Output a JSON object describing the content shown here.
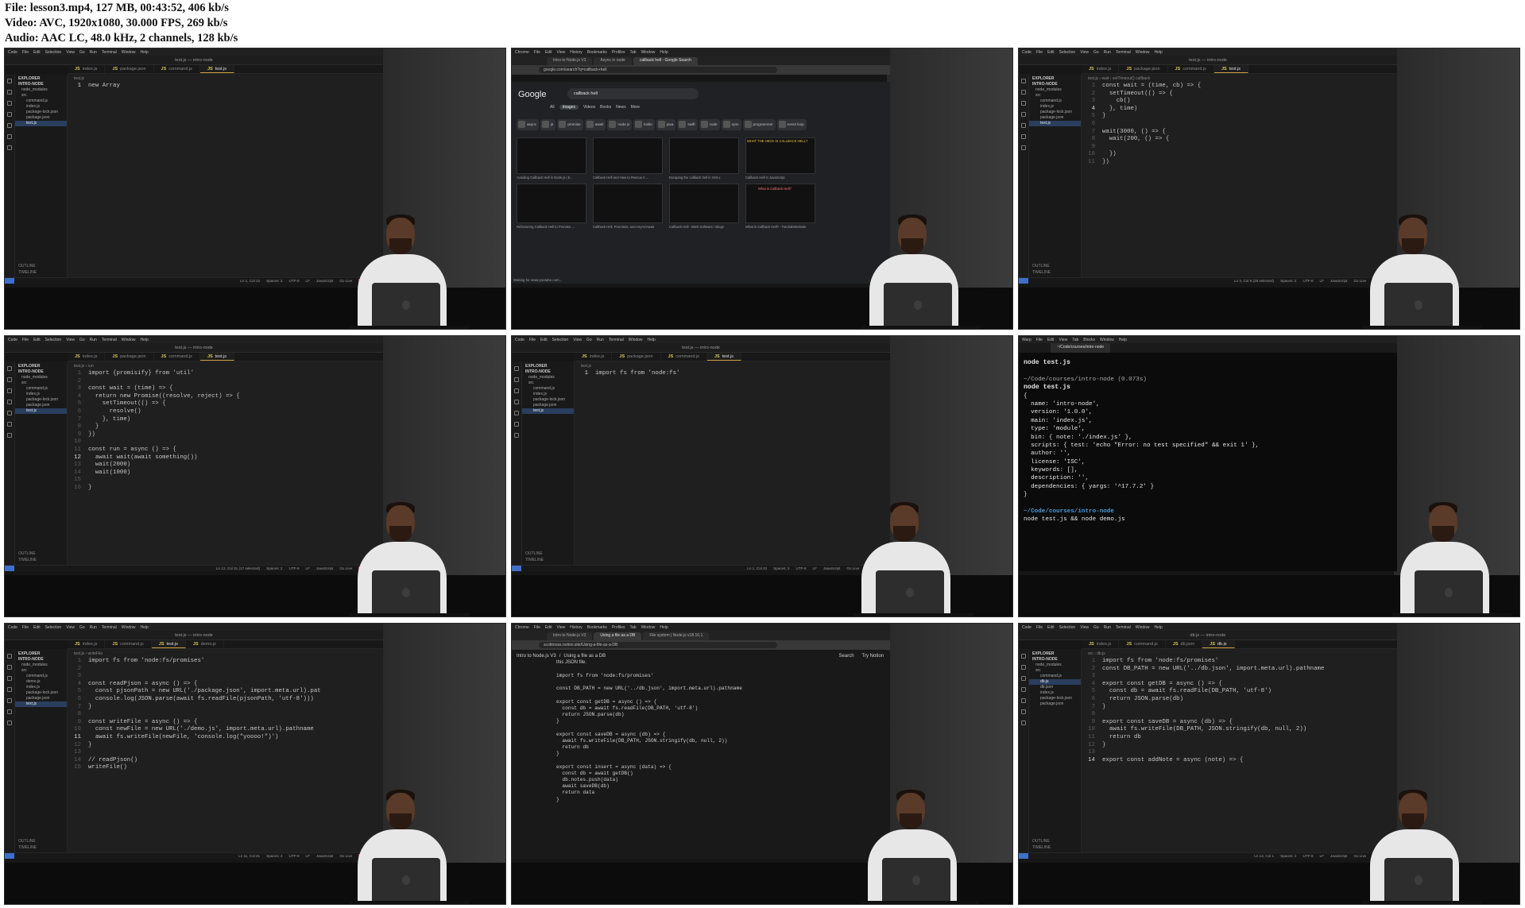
{
  "file_info": [
    "File: lesson3.mp4, 127 MB, 00:43:52, 406 kb/s",
    "Video: AVC, 1920x1080, 30.000 FPS, 269 kb/s",
    "Audio: AAC LC, 48.0 kHz, 2 channels, 128 kb/s"
  ],
  "menu": {
    "code": [
      "Code",
      "File",
      "Edit",
      "Selection",
      "View",
      "Go",
      "Run",
      "Terminal",
      "Window",
      "Help"
    ],
    "chrome": [
      "Chrome",
      "File",
      "Edit",
      "View",
      "History",
      "Bookmarks",
      "Profiles",
      "Tab",
      "Window",
      "Help"
    ],
    "warp": [
      "Warp",
      "File",
      "Edit",
      "View",
      "Tab",
      "Blocks",
      "Window",
      "Help"
    ]
  },
  "explorer": {
    "header": "EXPLORER",
    "root": "INTRO-NODE",
    "outline": "OUTLINE",
    "timeline": "TIMELINE"
  },
  "statusbar": {
    "spaces": "Spaces: 2",
    "encoding": "UTF-8",
    "eol": "LF",
    "language": "JavaScript",
    "golive": "Go Live",
    "prettier": "Prettier"
  },
  "frames": [
    {
      "kind": "vscode",
      "title": "test.js — intro-node",
      "tabs": [
        "index.js",
        "package.json",
        "command.js",
        "test.js"
      ],
      "active_tab": 3,
      "breadcrumb": "test.js",
      "files": [
        "node_modules",
        "src",
        "command.js",
        "index.js",
        "package-lock.json",
        "package.json",
        "test.js"
      ],
      "selected_file": 6,
      "current_line": 1,
      "cursor": "Ln 1, Col 12",
      "lines": [
        {
          "n": 1,
          "t": "new Array"
        }
      ]
    },
    {
      "kind": "chrome",
      "tabs": [
        "Intro to Node.js V3",
        "Async in node",
        "callback hell - Google Search"
      ],
      "url": "google.com/search?q=callback+hell",
      "logo": "Google",
      "query": "callback hell",
      "chips": [
        "All",
        "Images",
        "Videos",
        "Books",
        "News",
        "More"
      ],
      "filters": [
        "async",
        "js",
        "promise",
        "await",
        "node js",
        "kotlin",
        "java",
        "swift",
        "code",
        "npm",
        "programmer",
        "event loop"
      ],
      "captions": [
        "Avoiding Callback Hell in Node.js | b...",
        "Callback Hell and How to Rescue it ...",
        "Escaping the callback hell in Vert.x",
        "Callback Hell in JavaScript",
        "Refactoring Callback Hell to Promise ...",
        "Callback Hell, Promises, and Async/Await",
        "Callback Hell - BMS Software / Blogs",
        "What is Callback Hell? - TutorialsWebsite"
      ],
      "banner": "WHAT THE HECK IS CALLBACK HELL?",
      "card": "What is Callback Hell?",
      "status": "Waiting for www.youtube.com..."
    },
    {
      "kind": "vscode",
      "title": "test.js — intro-node",
      "tabs": [
        "index.js",
        "package.json",
        "command.js",
        "test.js"
      ],
      "active_tab": 3,
      "breadcrumb": "test.js › wait › setTimeout() callback",
      "files": [
        "node_modules",
        "src",
        "command.js",
        "index.js",
        "package-lock.json",
        "package.json",
        "test.js"
      ],
      "selected_file": 6,
      "current_line": 4,
      "cursor": "Ln 3, Col 9 (28 selected)",
      "lines": [
        {
          "n": 1,
          "t": "const wait = (time, cb) => {"
        },
        {
          "n": 2,
          "t": "  setTimeout(() => {"
        },
        {
          "n": 3,
          "t": "    cb()"
        },
        {
          "n": 4,
          "t": "  }, time)"
        },
        {
          "n": 5,
          "t": "}"
        },
        {
          "n": 6,
          "t": ""
        },
        {
          "n": 7,
          "t": "wait(3000, () => {"
        },
        {
          "n": 8,
          "t": "  wait(200, () => {"
        },
        {
          "n": 9,
          "t": ""
        },
        {
          "n": 10,
          "t": "  })"
        },
        {
          "n": 11,
          "t": "})"
        }
      ]
    },
    {
      "kind": "vscode",
      "title": "test.js — intro-node",
      "tabs": [
        "index.js",
        "package.json",
        "command.js",
        "test.js"
      ],
      "active_tab": 3,
      "breadcrumb": "test.js › run",
      "files": [
        "node_modules",
        "src",
        "command.js",
        "index.js",
        "package-lock.json",
        "package.json",
        "test.js"
      ],
      "selected_file": 6,
      "current_line": 12,
      "cursor": "Ln 12, Col 31 (17 selected)",
      "lines": [
        {
          "n": 1,
          "t": "import {promisify} from 'util'"
        },
        {
          "n": 2,
          "t": ""
        },
        {
          "n": 3,
          "t": "const wait = (time) => {"
        },
        {
          "n": 4,
          "t": "  return new Promise((resolve, reject) => {"
        },
        {
          "n": 5,
          "t": "    setTimeout(() => {"
        },
        {
          "n": 6,
          "t": "      resolve()"
        },
        {
          "n": 7,
          "t": "    }, time)"
        },
        {
          "n": 8,
          "t": "  }"
        },
        {
          "n": 9,
          "t": "})"
        },
        {
          "n": 10,
          "t": ""
        },
        {
          "n": 11,
          "t": "const run = async () => {"
        },
        {
          "n": 12,
          "t": "  await wait(await something())"
        },
        {
          "n": 13,
          "t": "  wait(2000)"
        },
        {
          "n": 14,
          "t": "  wait(1000)"
        },
        {
          "n": 15,
          "t": ""
        },
        {
          "n": 16,
          "t": "}"
        }
      ]
    },
    {
      "kind": "vscode",
      "title": "test.js — intro-node",
      "tabs": [
        "index.js",
        "package.json",
        "command.js",
        "test.js"
      ],
      "active_tab": 3,
      "breadcrumb": "test.js",
      "files": [
        "node_modules",
        "src",
        "command.js",
        "index.js",
        "package-lock.json",
        "package.json",
        "test.js"
      ],
      "selected_file": 6,
      "current_line": 1,
      "cursor": "Ln 1, Col 23",
      "lines": [
        {
          "n": 1,
          "t": "import fs from 'node:fs'"
        }
      ]
    },
    {
      "kind": "terminal",
      "tabs": [
        "~/Code/courses/intro-node"
      ],
      "lines": [
        {
          "t": "node test.js",
          "c": "term-bold"
        },
        {
          "t": "",
          "c": ""
        },
        {
          "t": "~/Code/courses/intro-node (0.073s)",
          "c": "term-path"
        },
        {
          "t": "node test.js",
          "c": "term-bold"
        },
        {
          "t": "{",
          "c": ""
        },
        {
          "t": "  name: 'intro-node',",
          "c": ""
        },
        {
          "t": "  version: '1.0.0',",
          "c": ""
        },
        {
          "t": "  main: 'index.js',",
          "c": ""
        },
        {
          "t": "  type: 'module',",
          "c": ""
        },
        {
          "t": "  bin: { note: './index.js' },",
          "c": ""
        },
        {
          "t": "  scripts: { test: 'echo \"Error: no test specified\" && exit 1' },",
          "c": ""
        },
        {
          "t": "  author: '',",
          "c": ""
        },
        {
          "t": "  license: 'ISC',",
          "c": ""
        },
        {
          "t": "  keywords: [],",
          "c": ""
        },
        {
          "t": "  description: '',",
          "c": ""
        },
        {
          "t": "  dependencies: { yargs: '^17.7.2' }",
          "c": ""
        },
        {
          "t": "}",
          "c": ""
        },
        {
          "t": "",
          "c": ""
        },
        {
          "t": "~/Code/courses/intro-node",
          "c": "term-prompt"
        },
        {
          "t": "node test.js && node demo.js",
          "c": ""
        }
      ]
    },
    {
      "kind": "vscode",
      "title": "test.js — intro-node",
      "tabs": [
        "index.js",
        "command.js",
        "test.js",
        "demo.js"
      ],
      "active_tab": 2,
      "breadcrumb": "test.js › writeFile",
      "files": [
        "node_modules",
        "src",
        "command.js",
        "demo.js",
        "index.js",
        "package-lock.json",
        "package.json",
        "test.js"
      ],
      "selected_file": 7,
      "current_line": 11,
      "cursor": "Ln 11, Col 21",
      "lines": [
        {
          "n": 1,
          "t": "import fs from 'node:fs/promises'"
        },
        {
          "n": 2,
          "t": ""
        },
        {
          "n": 3,
          "t": ""
        },
        {
          "n": 4,
          "t": "const readPjson = async () => {"
        },
        {
          "n": 5,
          "t": "  const pjsonPath = new URL('./package.json', import.meta.url).pat"
        },
        {
          "n": 6,
          "t": "  console.log(JSON.parse(await fs.readFile(pjsonPath, 'utf-8')))"
        },
        {
          "n": 7,
          "t": "}"
        },
        {
          "n": 8,
          "t": ""
        },
        {
          "n": 9,
          "t": "const writeFile = async () => {"
        },
        {
          "n": 10,
          "t": "  const newFile = new URL('./demo.js', import.meta.url).pathname"
        },
        {
          "n": 11,
          "t": "  await fs.writeFile(newFile, 'console.log(\"yoooo!\")')"
        },
        {
          "n": 12,
          "t": "}"
        },
        {
          "n": 13,
          "t": ""
        },
        {
          "n": 14,
          "t": "// readPjson()"
        },
        {
          "n": 15,
          "t": "writeFile()"
        }
      ]
    },
    {
      "kind": "notion",
      "tabs": [
        "Intro to Node.js V3",
        "Using a file as a DB",
        "File system | Node.js v18.16.1"
      ],
      "url": "scottmoss.notion.site/Using-a-file-as-a-DB",
      "page_title": "Intro to Node.js V3",
      "page_sub": "Using a file as a DB",
      "actions": [
        "Search",
        "Try Notion"
      ],
      "intro": "this JSON file.",
      "lines": [
        "import fs from 'node:fs/promises'",
        "",
        "const DB_PATH = new URL('../db.json', import.meta.url).pathname",
        "",
        "export const getDB = async () => {",
        "  const db = await fs.readFile(DB_PATH, 'utf-8')",
        "  return JSON.parse(db)",
        "}",
        "",
        "export const saveDB = async (db) => {",
        "  await fs.writeFile(DB_PATH, JSON.stringify(db, null, 2))",
        "  return db",
        "}",
        "",
        "export const insert = async (data) => {",
        "  const db = await getDB()",
        "  db.notes.push(data)",
        "  await saveDB(db)",
        "  return data",
        "}"
      ]
    },
    {
      "kind": "vscode",
      "title": "db.js — intro-node",
      "tabs": [
        "index.js",
        "command.js",
        "db.json",
        "db.js"
      ],
      "active_tab": 3,
      "breadcrumb": "src › db.js",
      "files": [
        "node_modules",
        "src",
        "command.js",
        "db.js",
        "db.json",
        "index.js",
        "package-lock.json",
        "package.json"
      ],
      "selected_file": 3,
      "current_line": 14,
      "cursor": "Ln 14, Col 1",
      "lines": [
        {
          "n": 1,
          "t": "import fs from 'node:fs/promises'"
        },
        {
          "n": 2,
          "t": "const DB_PATH = new URL('../db.json', import.meta.url).pathname"
        },
        {
          "n": 3,
          "t": ""
        },
        {
          "n": 4,
          "t": "export const getDB = async () => {"
        },
        {
          "n": 5,
          "t": "  const db = await fs.readFile(DB_PATH, 'utf-8')"
        },
        {
          "n": 6,
          "t": "  return JSON.parse(db)"
        },
        {
          "n": 7,
          "t": "}"
        },
        {
          "n": 8,
          "t": ""
        },
        {
          "n": 9,
          "t": "export const saveDB = async (db) => {"
        },
        {
          "n": 10,
          "t": "  await fs.writeFile(DB_PATH, JSON.stringify(db, null, 2))"
        },
        {
          "n": 11,
          "t": "  return db"
        },
        {
          "n": 12,
          "t": "}"
        },
        {
          "n": 13,
          "t": ""
        },
        {
          "n": 14,
          "t": "export const addNote = async (note) => {"
        }
      ]
    }
  ]
}
